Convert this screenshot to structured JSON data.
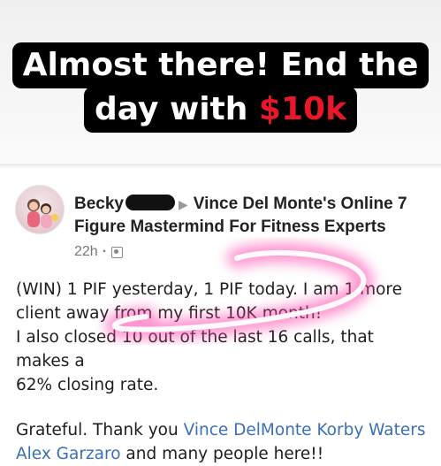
{
  "caption": {
    "line1": "Almost there! End the",
    "line2_prefix": "day with ",
    "line2_amount": "$10k"
  },
  "post": {
    "author": "Becky",
    "group": "Vince Del Monte's Online 7 Figure Mastermind For Fitness Experts",
    "time": "22h",
    "audience_icon": "group-icon",
    "body": {
      "line1": "(WIN) 1 PIF yesterday, 1 PIF today. I am 1 more",
      "line2": "client away from my first 10K month!",
      "line3": "I also closed 10 out of the last 16 calls, that makes a",
      "line4": "62% closing rate.",
      "thanks_prefix": "Grateful. Thank you ",
      "mention1": "Vince DelMonte",
      "mention2": "Korby Waters",
      "mention3": "Alex Garzaro",
      "thanks_suffix": " and many people here!!"
    }
  },
  "colors": {
    "caption_bg": "#000000",
    "amount": "#e8182a",
    "mention": "#3b6fb6",
    "highlight": "#ff3fa8"
  }
}
